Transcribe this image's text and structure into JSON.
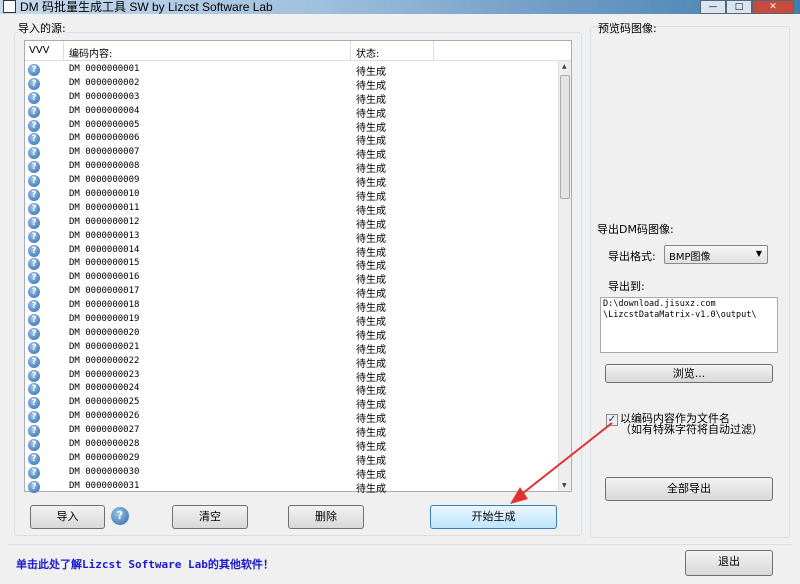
{
  "window": {
    "title": "DM 码批量生成工具 SW   by Lizcst Software Lab",
    "min": "—",
    "max": "□",
    "close": "✕"
  },
  "source": {
    "label": "导入的源:",
    "columns": [
      "VVV",
      "编码内容:",
      "状态:"
    ],
    "rows": [
      {
        "code": "DM 0000000001",
        "status": "待生成"
      },
      {
        "code": "DM 0000000002",
        "status": "待生成"
      },
      {
        "code": "DM 0000000003",
        "status": "待生成"
      },
      {
        "code": "DM 0000000004",
        "status": "待生成"
      },
      {
        "code": "DM 0000000005",
        "status": "待生成"
      },
      {
        "code": "DM 0000000006",
        "status": "待生成"
      },
      {
        "code": "DM 0000000007",
        "status": "待生成"
      },
      {
        "code": "DM 0000000008",
        "status": "待生成"
      },
      {
        "code": "DM 0000000009",
        "status": "待生成"
      },
      {
        "code": "DM 0000000010",
        "status": "待生成"
      },
      {
        "code": "DM 0000000011",
        "status": "待生成"
      },
      {
        "code": "DM 0000000012",
        "status": "待生成"
      },
      {
        "code": "DM 0000000013",
        "status": "待生成"
      },
      {
        "code": "DM 0000000014",
        "status": "待生成"
      },
      {
        "code": "DM 0000000015",
        "status": "待生成"
      },
      {
        "code": "DM 0000000016",
        "status": "待生成"
      },
      {
        "code": "DM 0000000017",
        "status": "待生成"
      },
      {
        "code": "DM 0000000018",
        "status": "待生成"
      },
      {
        "code": "DM 0000000019",
        "status": "待生成"
      },
      {
        "code": "DM 0000000020",
        "status": "待生成"
      },
      {
        "code": "DM 0000000021",
        "status": "待生成"
      },
      {
        "code": "DM 0000000022",
        "status": "待生成"
      },
      {
        "code": "DM 0000000023",
        "status": "待生成"
      },
      {
        "code": "DM 0000000024",
        "status": "待生成"
      },
      {
        "code": "DM 0000000025",
        "status": "待生成"
      },
      {
        "code": "DM 0000000026",
        "status": "待生成"
      },
      {
        "code": "DM 0000000027",
        "status": "待生成"
      },
      {
        "code": "DM 0000000028",
        "status": "待生成"
      },
      {
        "code": "DM 0000000029",
        "status": "待生成"
      },
      {
        "code": "DM 0000000030",
        "status": "待生成"
      },
      {
        "code": "DM 0000000031",
        "status": "待生成"
      }
    ]
  },
  "buttons": {
    "import": "导入",
    "help": "?",
    "clear": "清空",
    "delete": "删除",
    "start": "开始生成",
    "browse": "浏览...",
    "export_all": "全部导出",
    "exit": "退出"
  },
  "preview": {
    "label": "预览码图像:"
  },
  "export": {
    "label": "导出DM码图像:",
    "format_label": "导出格式:",
    "format_value": "BMP图像",
    "to_label": "导出到:",
    "path": "D:\\download.jisuxz.com\n\\LizcstDataMatrix-v1.0\\output\\",
    "checkbox_checked": true,
    "checkbox_label": "以编码内容作为文件名",
    "checkbox_note": "（如有特殊字符将自动过滤）"
  },
  "footer": {
    "link": "单击此处了解Lizcst Software Lab的其他软件！"
  },
  "colors": {
    "link": "#1a1ad0",
    "arrow": "#e03030"
  }
}
